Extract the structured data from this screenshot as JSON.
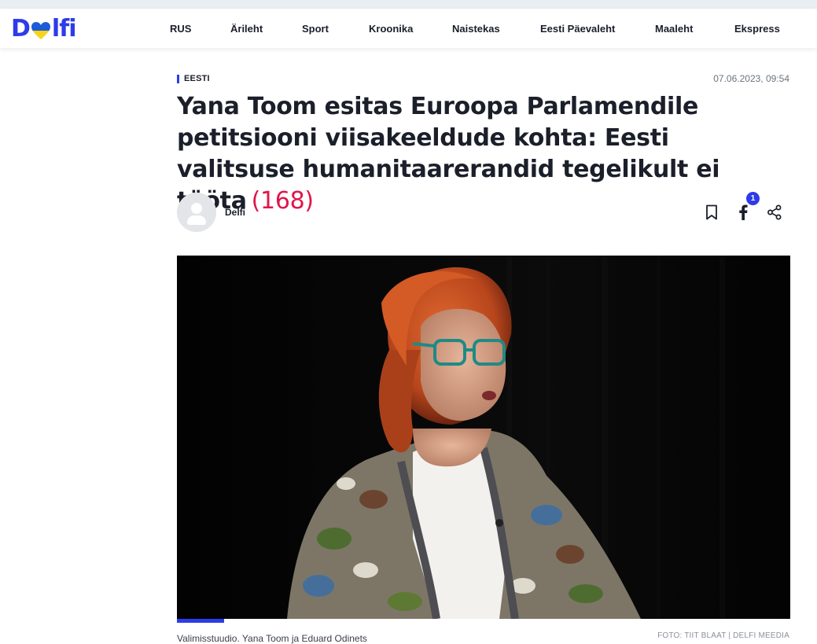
{
  "site": {
    "logo_text_left": "D",
    "logo_text_right": "lfi",
    "logo_colors": {
      "text": "#2d3be8",
      "heart_top": "#1e5bd6",
      "heart_bottom": "#f7d417"
    }
  },
  "nav": {
    "items": [
      {
        "label": "RUS"
      },
      {
        "label": "Ärileht"
      },
      {
        "label": "Sport"
      },
      {
        "label": "Kroonika"
      },
      {
        "label": "Naistekas"
      },
      {
        "label": "Eesti Päevaleht"
      },
      {
        "label": "Maaleht"
      },
      {
        "label": "Ekspress"
      }
    ]
  },
  "article": {
    "category": "EESTI",
    "date": "07.06.2023, 09:54",
    "title": "Yana Toom esitas Euroopa Parlamendile petitsiooni viisakeeldude kohta: Eesti valitsuse humanitaarerandid tegelikult ei tööta",
    "comments": "(168)",
    "author": "Delfi",
    "share_count": "1",
    "icons": {
      "bookmark": "bookmark-icon",
      "facebook": "facebook-icon",
      "share": "share-icon",
      "avatar": "user-avatar-icon"
    },
    "caption": "Valimisstuudio. Yana Toom ja Eduard Odinets",
    "credit": "FOTO: TIIT BLAAT | DELFI MEEDIA"
  },
  "colors": {
    "accent": "#2d3be8",
    "comments": "#e0154a"
  }
}
